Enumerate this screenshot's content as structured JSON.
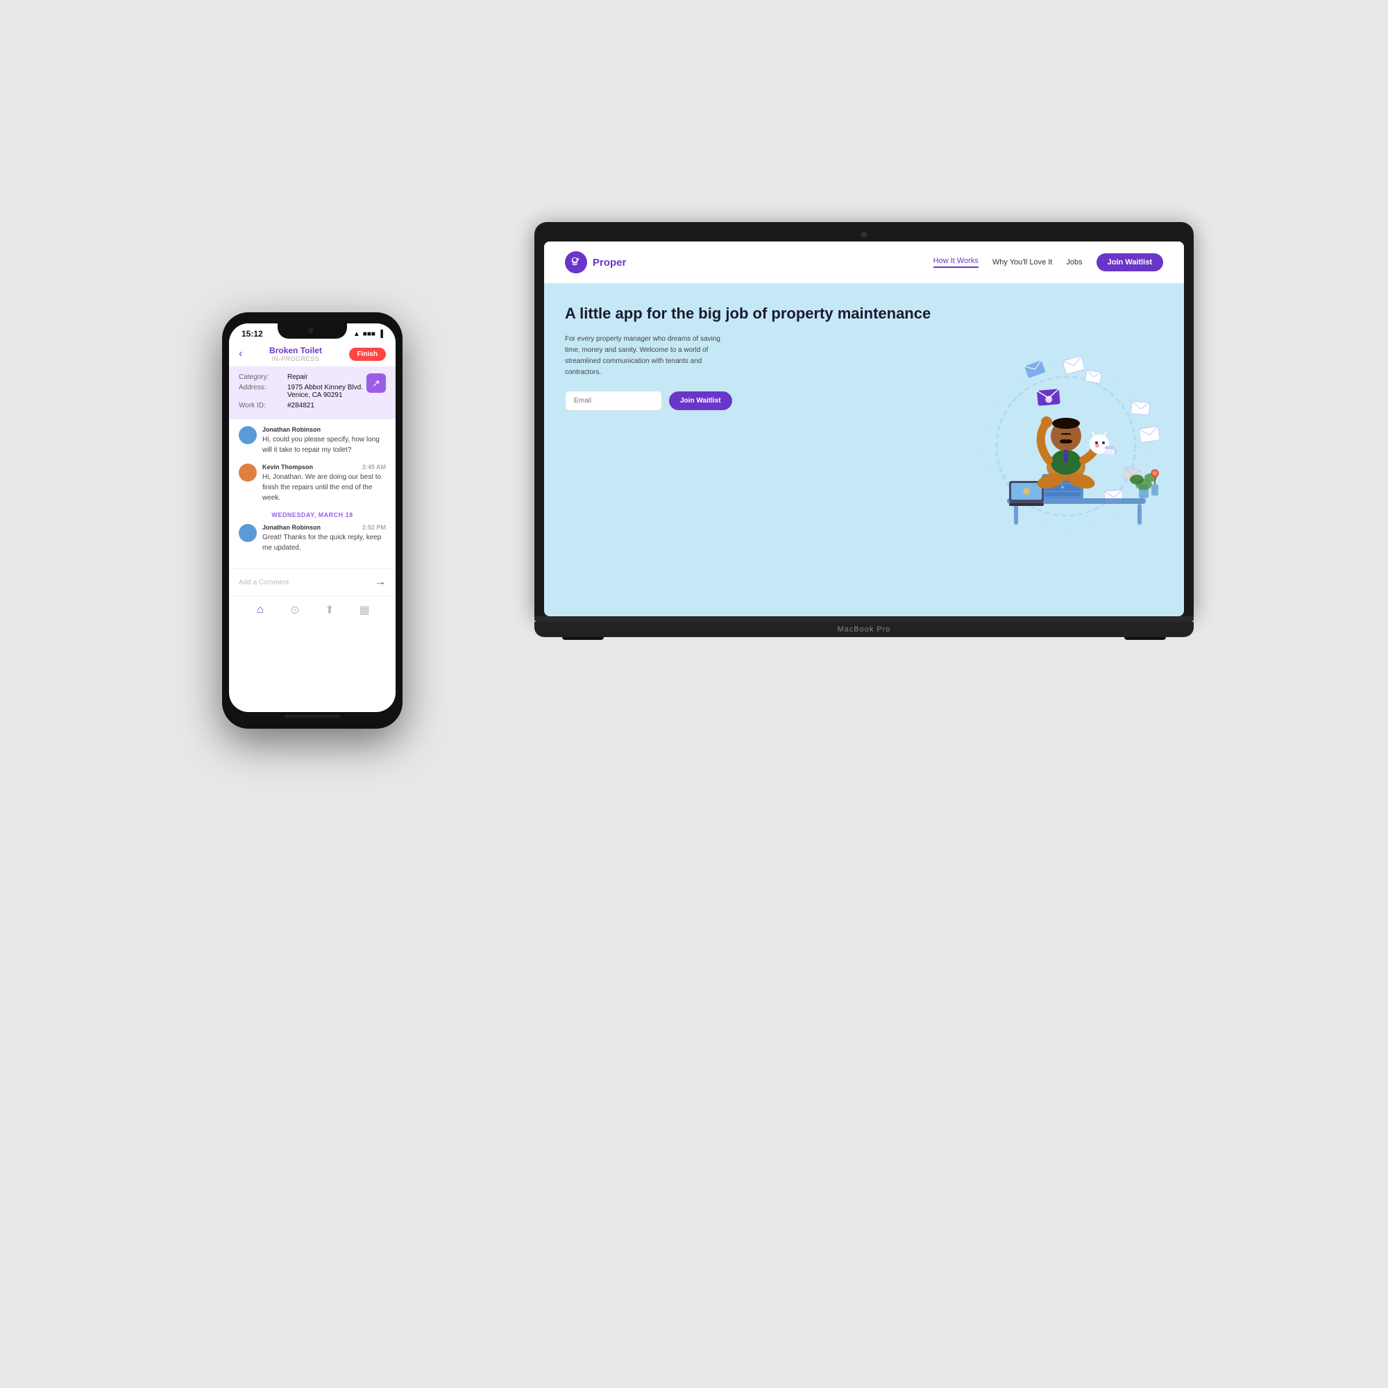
{
  "background_color": "#e8e8e8",
  "laptop": {
    "brand_label": "MacBook Pro",
    "website": {
      "logo_text": "Proper",
      "logo_icon": "🐶",
      "nav_links": [
        {
          "label": "How It Works",
          "active": true
        },
        {
          "label": "Why You'll Love It",
          "active": false
        },
        {
          "label": "Jobs",
          "active": false
        }
      ],
      "nav_cta": "Join Waitlist",
      "hero_title": "A little app for the big job of property maintenance",
      "hero_subtitle": "For every property manager who dreams of saving time, money and sanity. Welcome to a world of streamlined communication with tenants and contractors.",
      "email_placeholder": "Email",
      "hero_cta": "Join Waitlist"
    }
  },
  "phone": {
    "status_time": "15:12",
    "status_wifi": "WiFi",
    "status_signal": "Signal",
    "status_battery": "Battery",
    "header": {
      "back_icon": "‹",
      "title": "Broken Toilet",
      "subtitle": "IN-PROGRESS",
      "finish_btn": "Finish"
    },
    "details": {
      "category_label": "Category:",
      "category_value": "Repair",
      "address_label": "Address:",
      "address_value": "1975 Abbot Kinney Blvd. Venice, CA 90291",
      "workid_label": "Work ID:",
      "workid_value": "#284821"
    },
    "messages": [
      {
        "sender": "Jonathan Robinson",
        "avatar_color": "blue",
        "time": "",
        "text": "Hi, could you please specify, how long will it take to repair my toilet?"
      },
      {
        "sender": "Kevin Thompson",
        "avatar_color": "orange",
        "time": "3:45 AM",
        "text": "Hi, Jonathan. We are doing our best to finish the repairs until the end of the week."
      }
    ],
    "date_divider": "WEDNESDAY, MARCH 18",
    "messages2": [
      {
        "sender": "Jonathan Robinson",
        "avatar_color": "blue",
        "time": "2:52 PM",
        "text": "Great! Thanks for the quick reply, keep me updated."
      }
    ],
    "comment_placeholder": "Add a Comment",
    "nav_items": [
      "home",
      "link",
      "share",
      "grid"
    ]
  }
}
